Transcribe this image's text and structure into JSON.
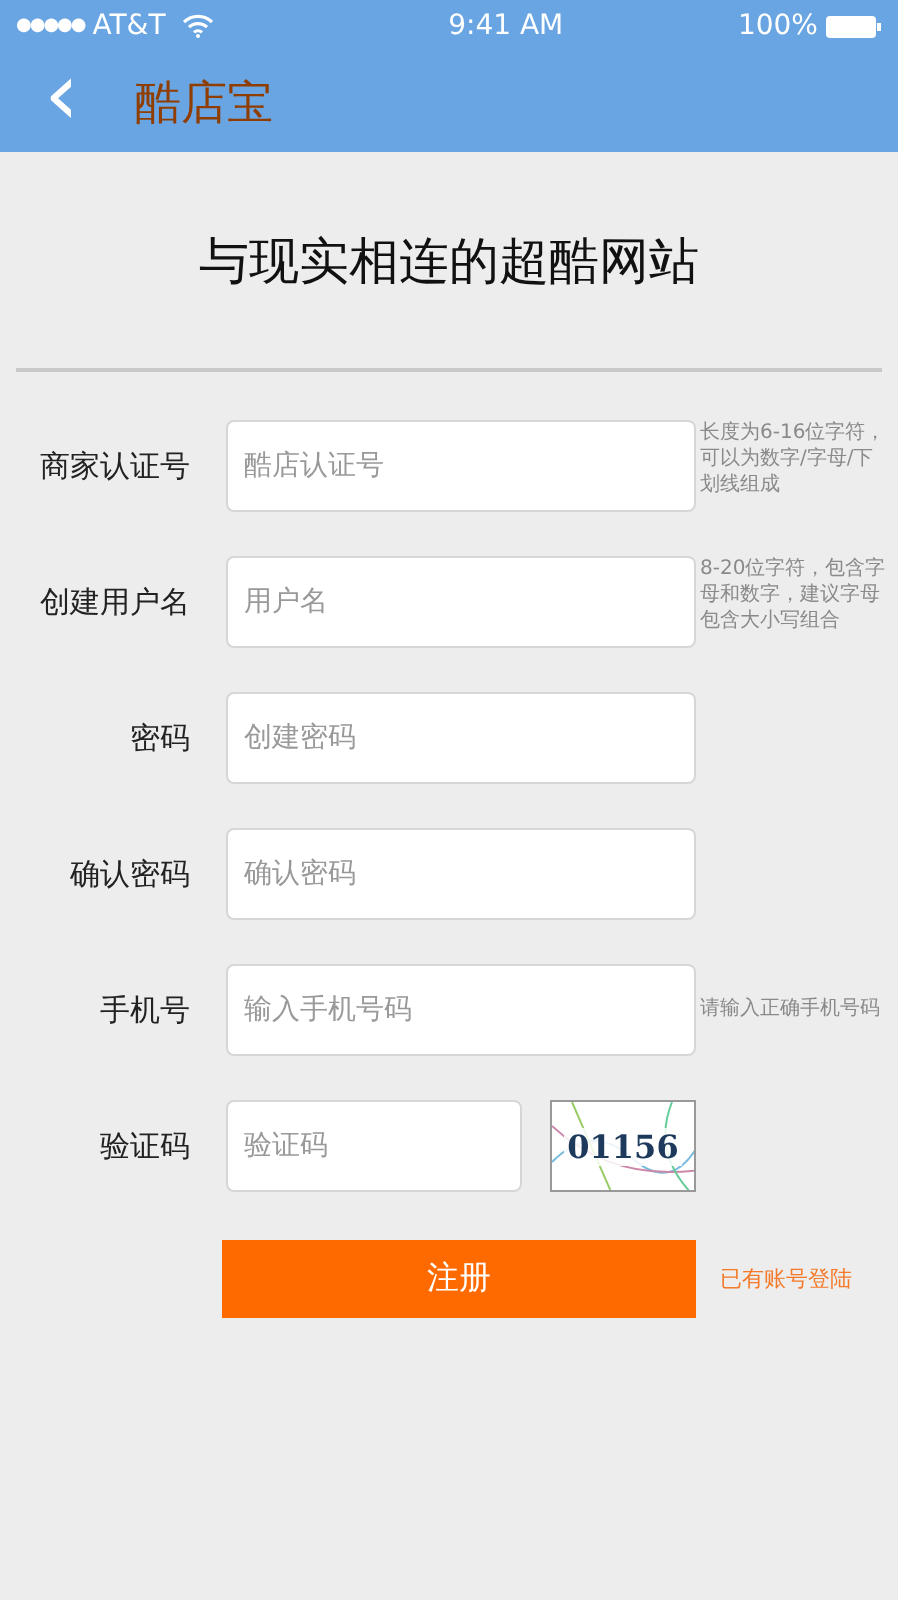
{
  "status_bar": {
    "signal": "●●●●●",
    "carrier": "AT&T",
    "time": "9:41 AM",
    "battery": "100%"
  },
  "nav": {
    "back": "‹",
    "title": "酷店宝"
  },
  "heading": "与现实相连的超酷网站",
  "fields": [
    {
      "label": "商家认证号",
      "placeholder": "酷店认证号",
      "hint": "长度为6-16位字符，可以为数字/字母/下划线组成",
      "kind": "input"
    },
    {
      "label": "创建用户名",
      "placeholder": "用户名",
      "hint": "8-20位字符，包含字母和数字，建议字母包含大小写组合",
      "kind": "input"
    },
    {
      "label": "密码",
      "placeholder": "创建密码",
      "kind": "input"
    },
    {
      "label": "确认密码",
      "placeholder": "确认密码",
      "kind": "input"
    },
    {
      "label": "手机号",
      "placeholder": "输入手机号码",
      "hint": "请输入正确手机号码",
      "kind": "input"
    },
    {
      "label": "验证码",
      "placeholder": "验证码",
      "captcha": "01156",
      "kind": "captcha"
    }
  ],
  "submit": "注册",
  "login_link": "已有账号登陆"
}
